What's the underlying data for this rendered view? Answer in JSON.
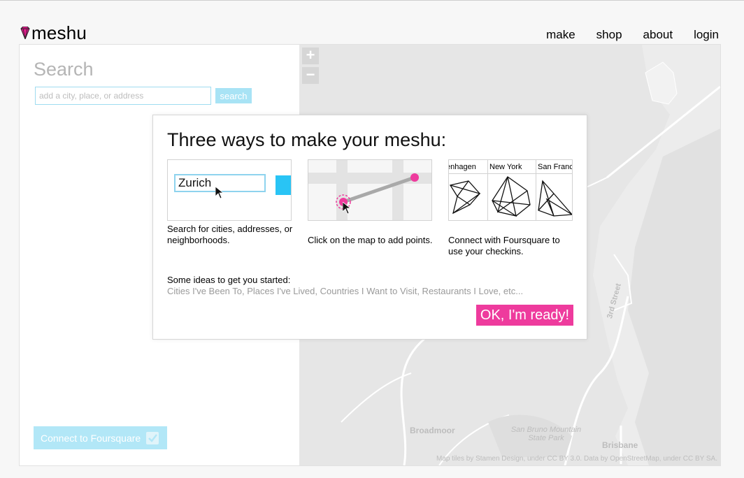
{
  "header": {
    "logo_text": "meshu",
    "nav": [
      "make",
      "shop",
      "about",
      "login"
    ]
  },
  "sidebar": {
    "heading": "Search",
    "search_placeholder": "add a city, place, or address",
    "search_button": "search",
    "foursquare_button": "Connect to Foursquare"
  },
  "map": {
    "zoom_in": "+",
    "zoom_out": "−",
    "labels": [
      "3rd Street",
      "Broadmoor",
      "San Bruno Mountain State Park",
      "Brisbane"
    ],
    "attribution": "Map tiles by Stamen Design, under CC BY 3.0. Data by OpenStreetMap, under CC BY SA."
  },
  "modal": {
    "title": "Three ways to make your meshu:",
    "demo_search_value": "Zurich",
    "cities": [
      "enhagen",
      "New York",
      "San Franc"
    ],
    "captions": [
      "Search for cities, addresses, or neighborhoods.",
      "Click on the map to add points.",
      "Connect with Foursquare to use your checkins."
    ],
    "ideas_label": "Some ideas to get you started:",
    "ideas_list": "Cities I've Been To, Places I've Lived, Countries I Want to Visit, Restaurants I Love, etc...",
    "ready_button": "OK, I'm ready!"
  },
  "colors": {
    "accent_pink": "#ee3b9d",
    "accent_blue": "#29c4f5",
    "light_blue": "#a8e3f5"
  },
  "icons": [
    "gem-logo-icon",
    "cursor-icon",
    "checkmark-icon"
  ]
}
